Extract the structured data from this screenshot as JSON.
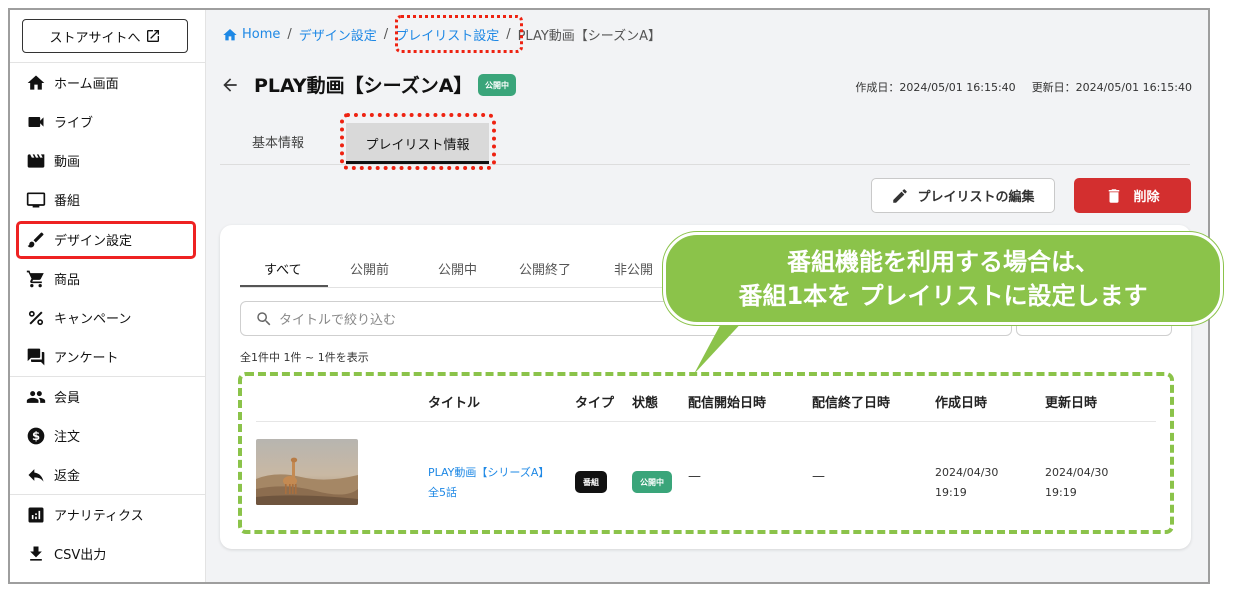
{
  "sidebar": {
    "store_button": "ストアサイトへ",
    "items": [
      {
        "label": "ホーム画面",
        "icon": "home-icon"
      },
      {
        "label": "ライブ",
        "icon": "videocam-icon"
      },
      {
        "label": "動画",
        "icon": "movie-icon"
      },
      {
        "label": "番組",
        "icon": "tv-icon"
      },
      {
        "label": "デザイン設定",
        "icon": "brush-icon"
      },
      {
        "label": "商品",
        "icon": "cart-icon"
      },
      {
        "label": "キャンペーン",
        "icon": "percent-icon"
      },
      {
        "label": "アンケート",
        "icon": "forum-icon"
      },
      {
        "label": "会員",
        "icon": "people-icon"
      },
      {
        "label": "注文",
        "icon": "dollar-icon"
      },
      {
        "label": "返金",
        "icon": "reply-icon"
      },
      {
        "label": "アナリティクス",
        "icon": "analytics-icon"
      },
      {
        "label": "CSV出力",
        "icon": "download-icon"
      }
    ]
  },
  "breadcrumb": {
    "home": "Home",
    "sep": "/",
    "design": "デザイン設定",
    "playlist": "プレイリスト設定",
    "current": "PLAY動画【シーズンA】"
  },
  "page": {
    "title": "PLAY動画【シーズンA】",
    "status_badge": "公開中",
    "created": "作成日：2024/05/01 16:15:40",
    "updated": "更新日：2024/05/01 16:15:40"
  },
  "tabs": {
    "basic": "基本情報",
    "playlist": "プレイリスト情報"
  },
  "actions": {
    "edit": "プレイリストの編集",
    "delete": "削除"
  },
  "filter_tabs": [
    "すべて",
    "公開前",
    "公開中",
    "公開終了",
    "非公開"
  ],
  "search": {
    "placeholder": "タイトルで絞り込む"
  },
  "count_text": "全1件中 1件 ~ 1件を表示",
  "table": {
    "headers": {
      "title": "タイトル",
      "type": "タイプ",
      "status": "状態",
      "start": "配信開始日時",
      "end": "配信終了日時",
      "created": "作成日時",
      "updated": "更新日時"
    },
    "row": {
      "title_line1": "PLAY動画【シリーズA】",
      "title_line2": "全5話",
      "type": "番組",
      "status": "公開中",
      "start": "—",
      "end": "—",
      "created_date": "2024/04/30",
      "created_time": "19:19",
      "updated_date": "2024/04/30",
      "updated_time": "19:19"
    }
  },
  "callout": {
    "text": "番組機能を利用する場合は、\n番組1本を プレイリストに設定します"
  },
  "colors": {
    "accent_link": "#1e88e5",
    "status_green": "#3aa57a",
    "delete_red": "#d32f2f",
    "callout_green": "#8bc34a",
    "highlight_red": "#e22222"
  }
}
